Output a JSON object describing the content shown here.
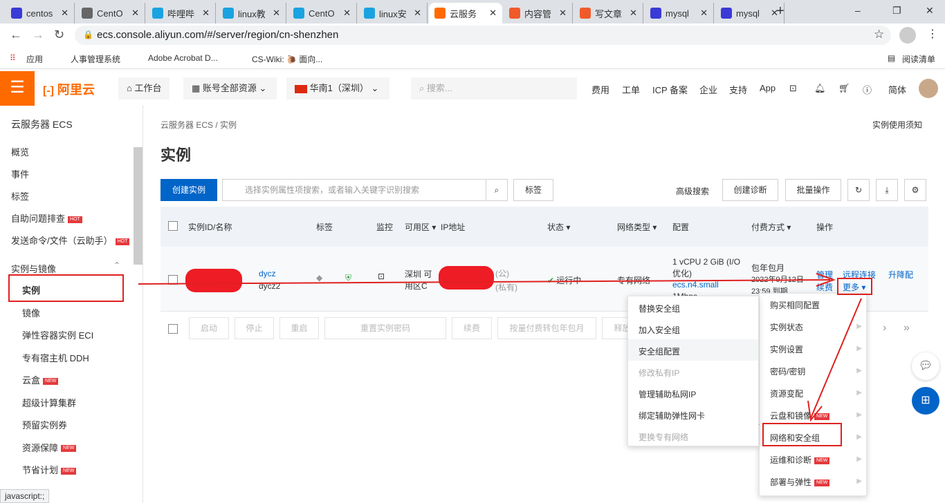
{
  "browser": {
    "tabs": [
      {
        "title": "centos",
        "color": "#3a3ad6"
      },
      {
        "title": "CentO",
        "color": "#666"
      },
      {
        "title": "哔哩哔",
        "color": "#1aa3e0"
      },
      {
        "title": "linux教",
        "color": "#1aa3e0"
      },
      {
        "title": "CentO",
        "color": "#1aa3e0"
      },
      {
        "title": "linux安",
        "color": "#1aa3e0"
      },
      {
        "title": "云服务",
        "color": "#ff6a00"
      },
      {
        "title": "内容管",
        "color": "#f05a2a"
      },
      {
        "title": "写文章",
        "color": "#f05a2a"
      },
      {
        "title": "mysql",
        "color": "#3a3ad6"
      },
      {
        "title": "mysql",
        "color": "#3a3ad6"
      }
    ],
    "active_tab": 6,
    "url": "ecs.console.aliyun.com/#/server/region/cn-shenzhen",
    "bookmarks": [
      "应用",
      "人事管理系统",
      "Adobe Acrobat D...",
      "CS-Wiki: 🐌 面向..."
    ],
    "reading_list": "阅读清单"
  },
  "header": {
    "logo": "阿里云",
    "workbench": "工作台",
    "resources": "账号全部资源",
    "region": "华南1（深圳）",
    "search_placeholder": "搜索...",
    "nav": [
      "费用",
      "工单",
      "ICP 备案",
      "企业",
      "支持",
      "App"
    ],
    "lang": "简体",
    "accent": "#ff6a00"
  },
  "sidebar": {
    "title": "云服务器 ECS",
    "items": [
      {
        "label": "概览"
      },
      {
        "label": "事件"
      },
      {
        "label": "标签"
      },
      {
        "label": "自助问题排查",
        "badge": "HOT"
      },
      {
        "label": "发送命令/文件（云助手）",
        "badge": "HOT"
      }
    ],
    "section": "实例与镜像",
    "sub": [
      {
        "label": "实例",
        "active": true
      },
      {
        "label": "镜像"
      },
      {
        "label": "弹性容器实例 ECI"
      },
      {
        "label": "专有宿主机 DDH"
      },
      {
        "label": "云盒",
        "badge": "NEW"
      },
      {
        "label": "超级计算集群"
      },
      {
        "label": "预留实例券"
      },
      {
        "label": "资源保障",
        "badge": "NEW"
      },
      {
        "label": "节省计划",
        "badge": "NEW"
      }
    ]
  },
  "main": {
    "breadcrumb": [
      "云服务器 ECS",
      "实例"
    ],
    "help": "实例使用须知",
    "title": "实例",
    "create": "创建实例",
    "search_placeholder": "选择实例属性项搜索，或者输入关键字识别搜索",
    "tag_btn": "标签",
    "adv_search": "高级搜索",
    "diagnose": "创建诊断",
    "batch": "批量操作",
    "columns": [
      "实例ID/名称",
      "标签",
      "监控",
      "可用区",
      "IP地址",
      "状态",
      "网络类型",
      "配置",
      "付费方式",
      "操作"
    ],
    "row": {
      "id_suffix": "dycz",
      "name_suffix": "dycz2",
      "zone": "深圳 可用区C",
      "ip_pub": "(公)",
      "ip_priv": "(私有)",
      "status": "运行中",
      "network": "专有网络",
      "config": "1 vCPU 2 GiB (I/O优化)",
      "type": "ecs.n4.small",
      "bw": "1Mbps",
      "pay": "包年包月",
      "expire": "2022年9月12日 23:59 到期",
      "ops": [
        "管理",
        "远程连接",
        "升降配",
        "续费",
        "更多"
      ]
    },
    "bulk": [
      "启动",
      "停止",
      "重启",
      "重置实例密码",
      "续费",
      "按量付费转包年包月",
      "释放设置"
    ]
  },
  "menu_more": [
    {
      "label": "购买相同配置"
    },
    {
      "label": "实例状态",
      "sub": true
    },
    {
      "label": "实例设置",
      "sub": true
    },
    {
      "label": "密码/密钥",
      "sub": true
    },
    {
      "label": "资源变配",
      "sub": true
    },
    {
      "label": "云盘和镜像",
      "sub": true,
      "badge": "NEW"
    },
    {
      "label": "网络和安全组",
      "sub": true
    },
    {
      "label": "运维和诊断",
      "sub": true,
      "badge": "NEW"
    },
    {
      "label": "部署与弹性",
      "sub": true,
      "badge": "NEW"
    }
  ],
  "menu_net": [
    {
      "label": "替换安全组"
    },
    {
      "label": "加入安全组"
    },
    {
      "label": "安全组配置"
    },
    {
      "label": "修改私有IP",
      "disabled": true
    },
    {
      "label": "管理辅助私网IP"
    },
    {
      "label": "绑定辅助弹性网卡"
    },
    {
      "label": "更换专有网络",
      "disabled": true
    }
  ],
  "statusbar": "javascript:;"
}
